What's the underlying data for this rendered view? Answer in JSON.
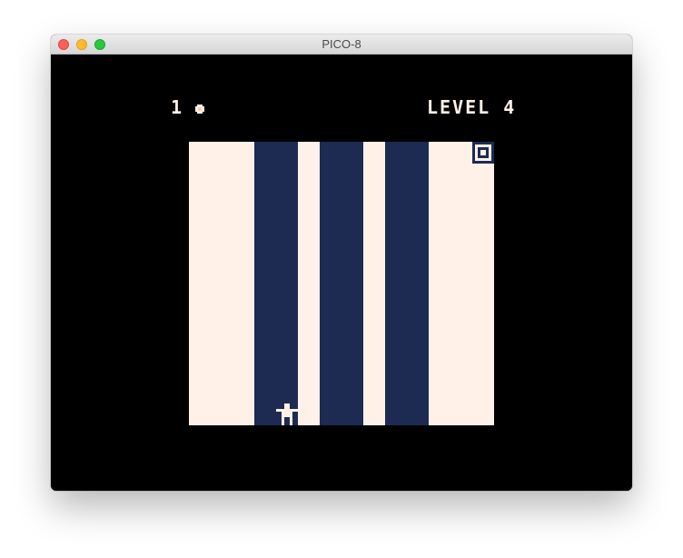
{
  "window": {
    "title": "PICO-8"
  },
  "hud": {
    "lives": "1",
    "level": "LEVEL 4"
  },
  "colors": {
    "floor": "#fff1e8",
    "wall": "#1d2b53",
    "background": "#000000"
  },
  "icons": {
    "life": "coin-icon",
    "goal": "goal-square-icon",
    "player": "player-sprite-icon"
  }
}
